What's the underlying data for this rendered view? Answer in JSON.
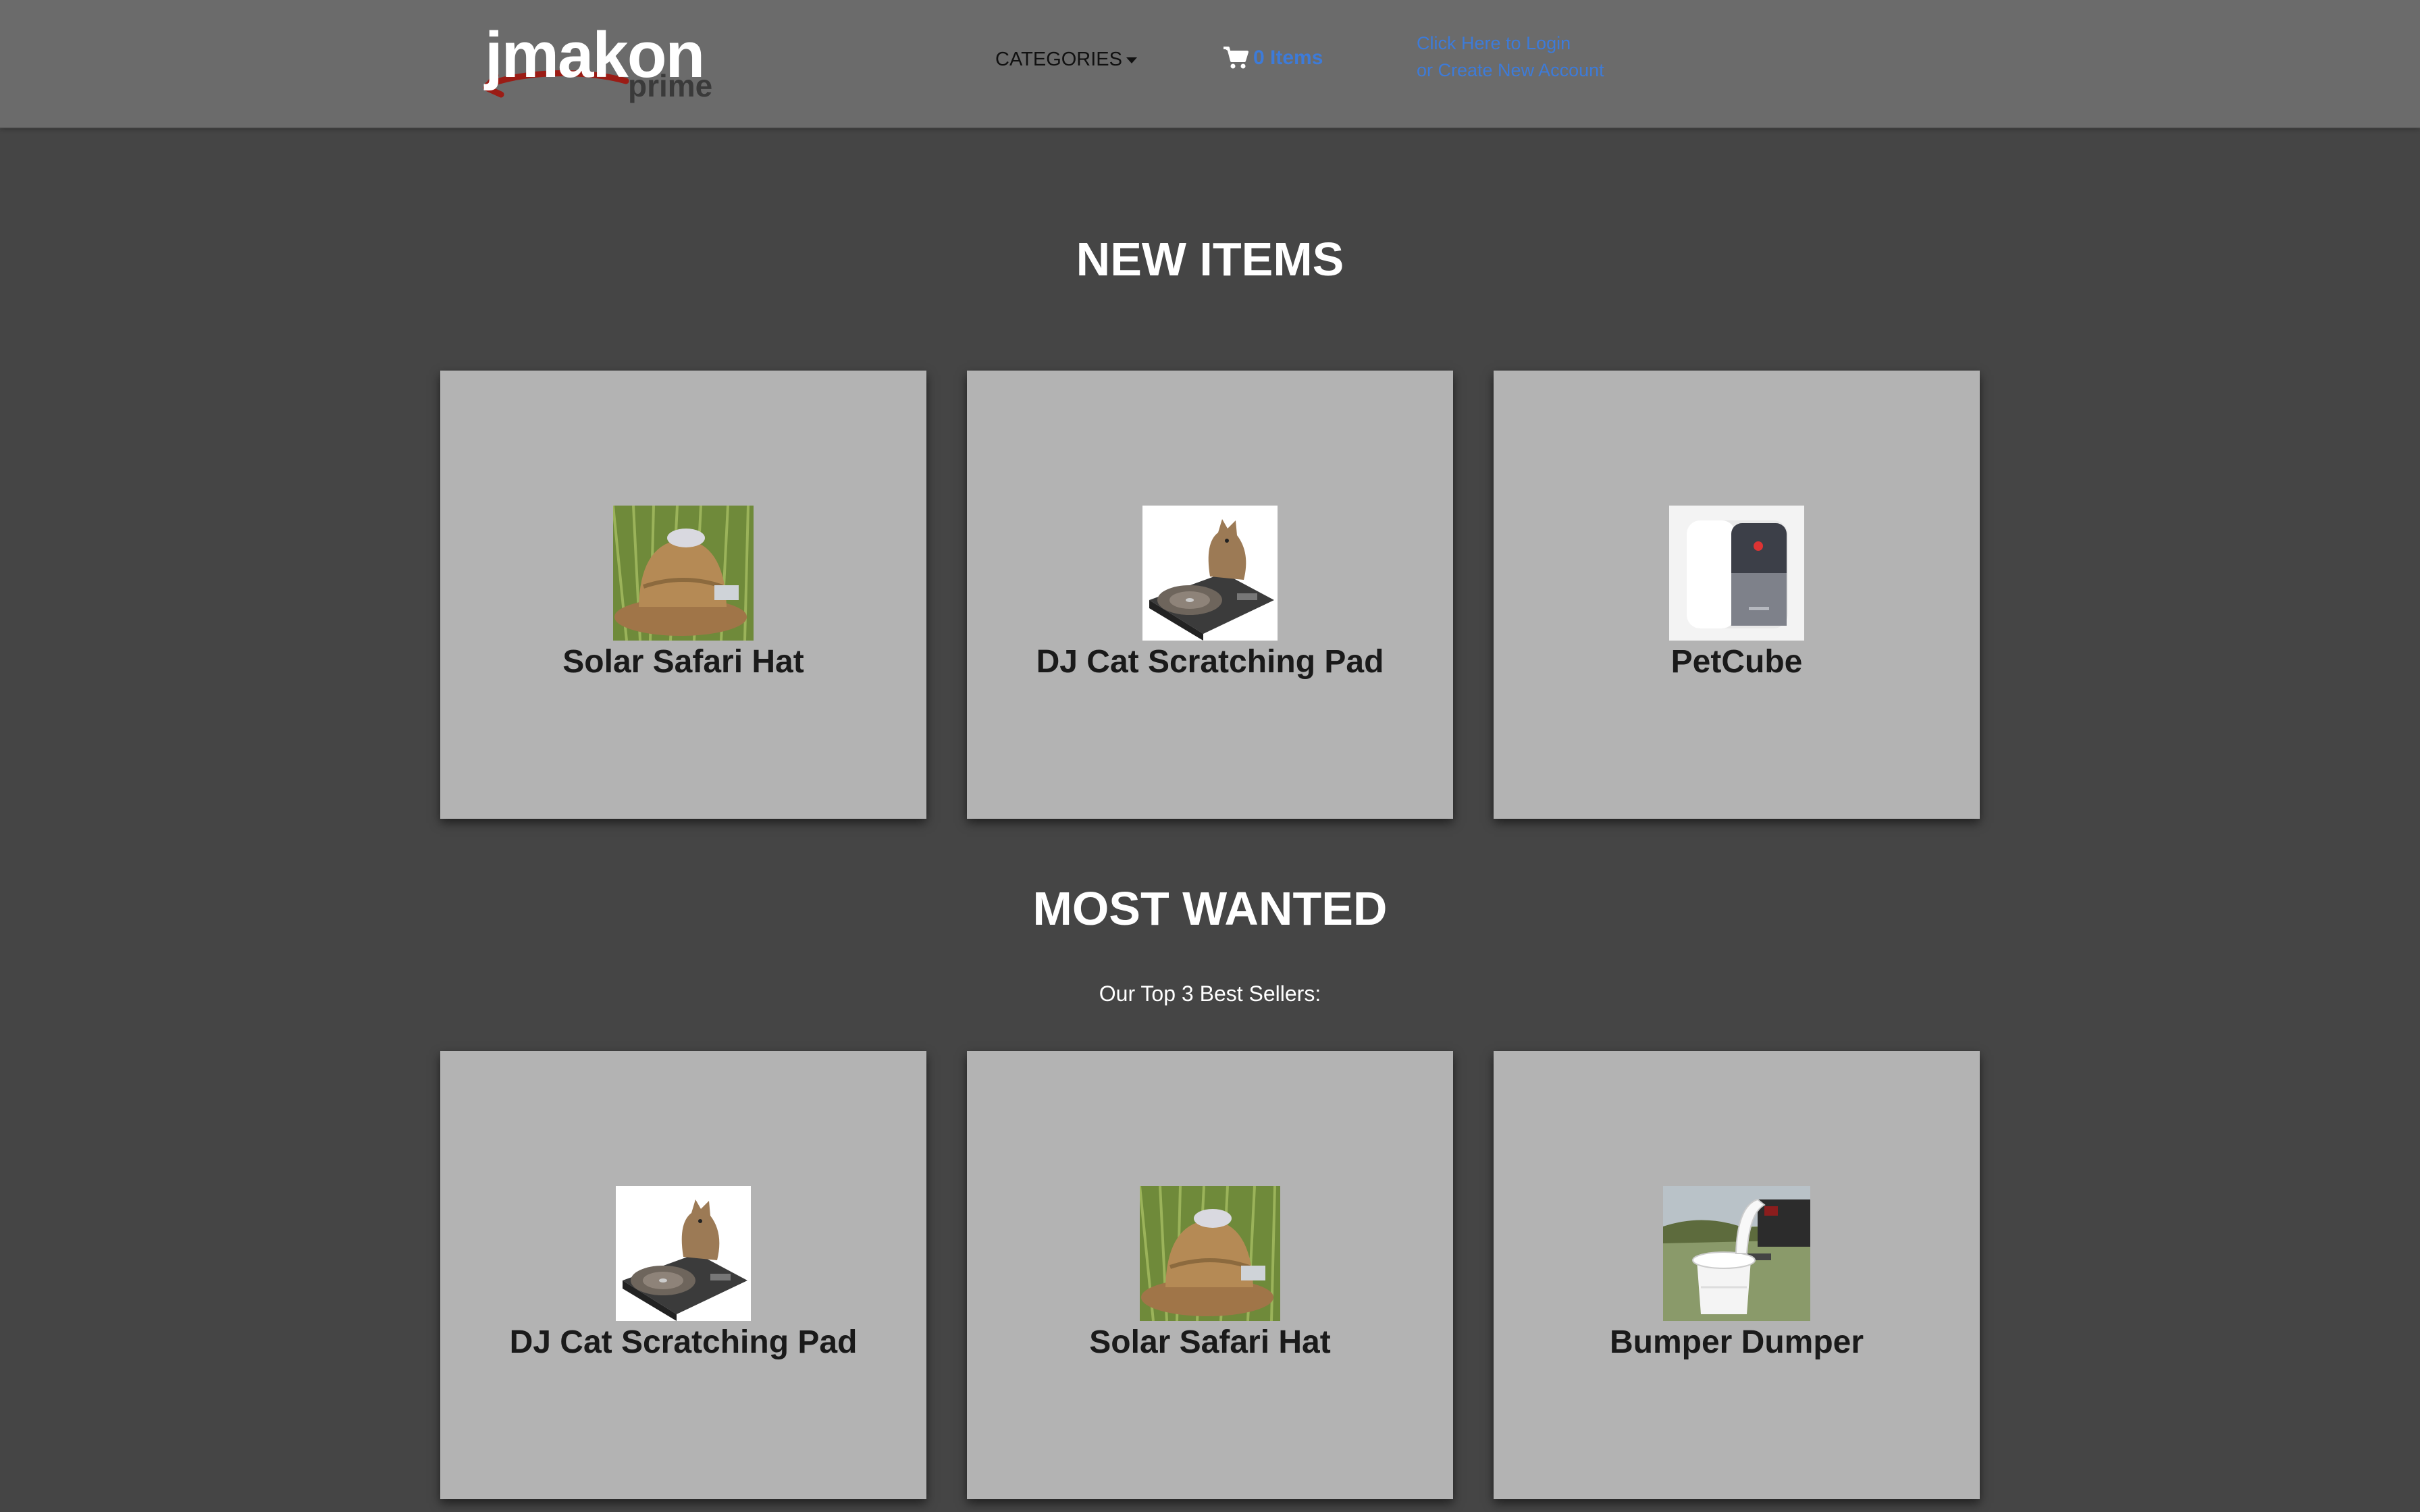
{
  "brand": {
    "logo_main": "jmakon",
    "logo_sub": "prime",
    "swoosh_color": "#9b1c15"
  },
  "nav": {
    "categories_label": "CATEGORIES",
    "cart_label": "0 Items",
    "login_line1": "Click Here to Login",
    "login_line2": "or Create New Account",
    "link_color": "#3d7bd9"
  },
  "new_items": {
    "title": "NEW ITEMS",
    "items": [
      {
        "name": "Solar Safari Hat",
        "image": "safari-hat-image"
      },
      {
        "name": "DJ Cat Scratching Pad",
        "image": "dj-cat-image"
      },
      {
        "name": "PetCube",
        "image": "petcube-image"
      }
    ]
  },
  "most_wanted": {
    "title": "MOST WANTED",
    "subtitle": "Our Top 3 Best Sellers:",
    "items": [
      {
        "name": "DJ Cat Scratching Pad",
        "image": "dj-cat-image"
      },
      {
        "name": "Solar Safari Hat",
        "image": "safari-hat-image"
      },
      {
        "name": "Bumper Dumper",
        "image": "bumper-dumper-image"
      }
    ]
  }
}
